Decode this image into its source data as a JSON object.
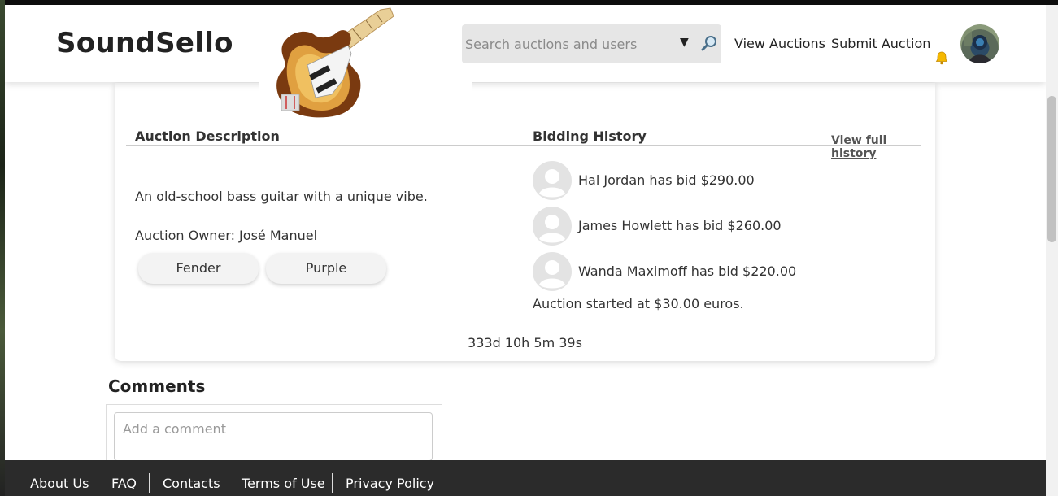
{
  "header": {
    "logo": "SoundSello",
    "search_placeholder": "Search auctions and users",
    "nav": {
      "view_auctions": "View Auctions",
      "submit_auction": "Submit Auction"
    }
  },
  "auction": {
    "description_title": "Auction Description",
    "description": "An old-school bass guitar with a unique vibe.",
    "owner": "Auction Owner: José Manuel",
    "tags": [
      "Fender",
      "Purple"
    ],
    "bidding_title": "Bidding History",
    "view_full_history": "View full history",
    "bids": [
      {
        "text": "Hal Jordan has bid $290.00"
      },
      {
        "text": "James Howlett has bid $260.00"
      },
      {
        "text": "Wanda Maximoff has bid $220.00"
      }
    ],
    "start_text": "Auction started at $30.00 euros.",
    "countdown": "333d 10h 5m 39s"
  },
  "comments": {
    "title": "Comments",
    "placeholder": "Add a comment"
  },
  "footer": {
    "links": [
      "About Us",
      "FAQ",
      "Contacts",
      "Terms of Use",
      "Privacy Policy"
    ]
  },
  "icons": {
    "search": "magnifier-icon",
    "dropdown": "triangle-down-icon",
    "notifications": "bell-icon",
    "user_avatar": "avatar-icon",
    "bidder_avatar": "default-user-icon"
  },
  "colors": {
    "footer_bg": "#2b2b2b",
    "search_bg": "#e6e6e6",
    "bell": "#f5b800"
  }
}
